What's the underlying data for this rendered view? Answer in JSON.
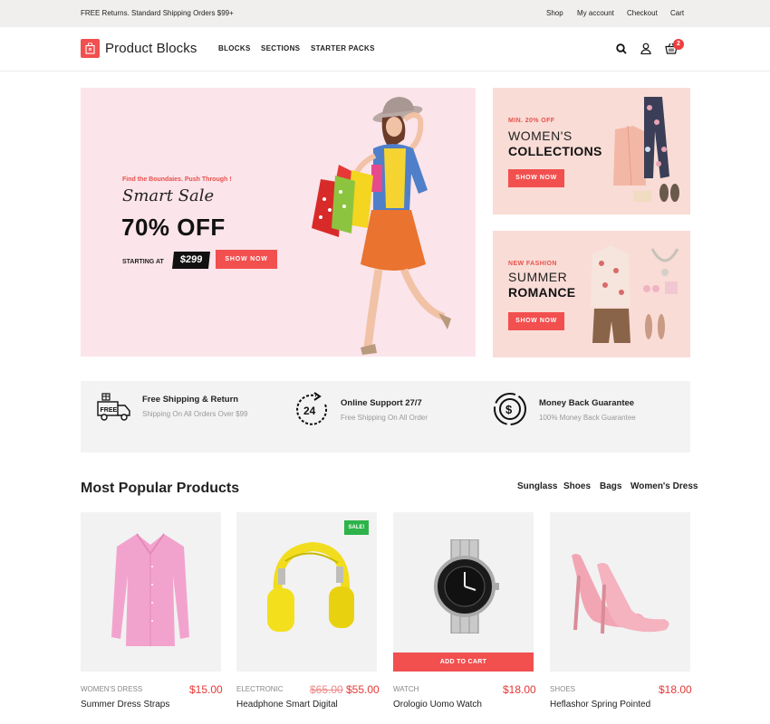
{
  "topbar": {
    "promo": "FREE Returns. Standard Shipping Orders $99+",
    "links": [
      "Shop",
      "My account",
      "Checkout",
      "Cart"
    ]
  },
  "header": {
    "logo": "Product Blocks",
    "nav": [
      "BLOCKS",
      "SECTIONS",
      "STARTER PACKS"
    ],
    "cart_count": "2"
  },
  "hero": {
    "kicker": "Find the Boundaies. Push Through !",
    "title": "Smart Sale",
    "headline": "70% OFF",
    "starting": "STARTING AT",
    "price": "$299",
    "button": "SHOW NOW"
  },
  "promos": [
    {
      "kicker": "MIN. 20% OFF",
      "line1": "WOMEN'S",
      "line2": "COLLECTIONS",
      "button": "SHOW NOW"
    },
    {
      "kicker": "NEW FASHION",
      "line1": "SUMMER",
      "line2": "ROMANCE",
      "button": "SHOW NOW"
    }
  ],
  "features": [
    {
      "icon": "free-delivery-truck-icon",
      "title": "Free Shipping & Return",
      "sub": "Shipping On All Orders Over $99",
      "icon_text": "FREE"
    },
    {
      "icon": "support-24-icon",
      "title": "Online Support 27/7",
      "sub": "Free Shipping On All Order",
      "icon_text": "24"
    },
    {
      "icon": "money-back-icon",
      "title": "Money Back Guarantee",
      "sub": "100% Money Back Guarantee"
    }
  ],
  "products_section": {
    "title": "Most Popular Products",
    "filters": [
      "Sunglass",
      "Shoes",
      "Bags",
      "Women's Dress"
    ]
  },
  "products": [
    {
      "category": "WOMEN'S DRESS",
      "price": "$15.00",
      "name": "Summer Dress Straps"
    },
    {
      "category": "ELECTRONIC",
      "old_price": "$65.00",
      "price": "$55.00",
      "name": "Headphone Smart Digital",
      "badge": "SALE!"
    },
    {
      "category": "WATCH",
      "price": "$18.00",
      "name": "Orologio Uomo Watch",
      "action": "ADD TO CART"
    },
    {
      "category": "SHOES",
      "price": "$18.00",
      "name": "Heflashor Spring Pointed"
    }
  ],
  "colors": {
    "accent": "#f24f4f",
    "hero_bg": "#fbe4ea",
    "promo_bg": "#f9dcd6",
    "sale": "#2db34a"
  }
}
